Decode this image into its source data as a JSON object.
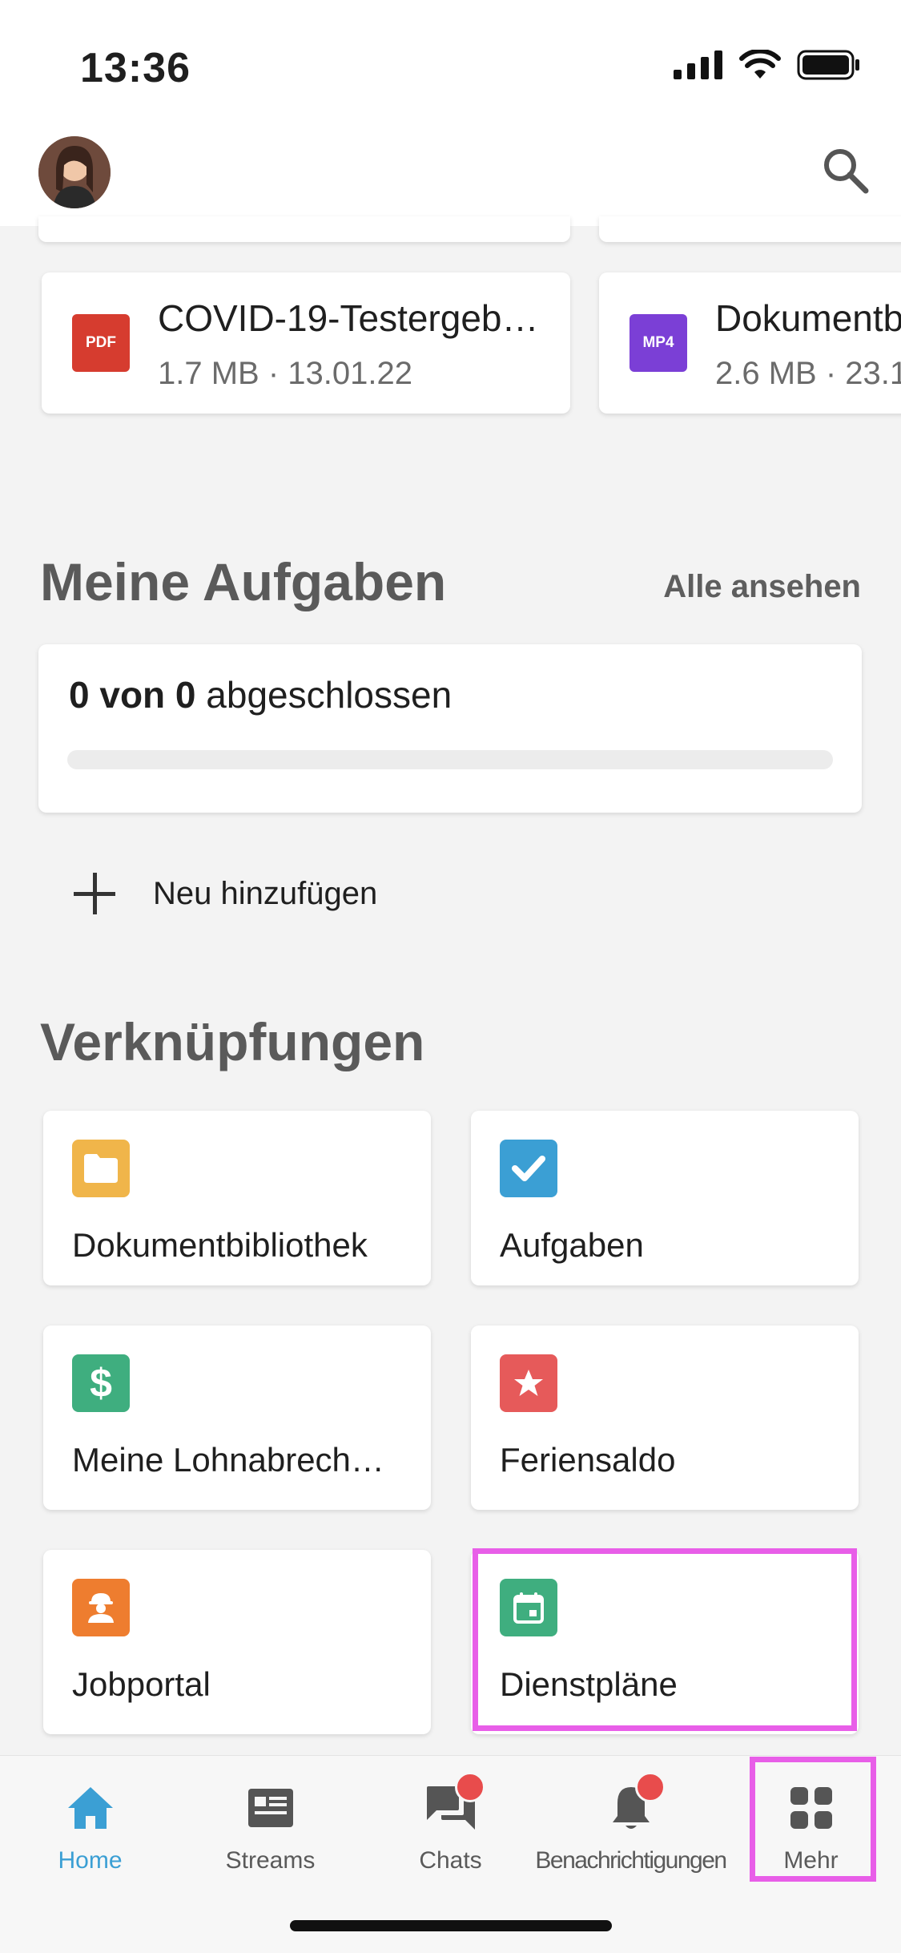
{
  "status_bar": {
    "time": "13:36"
  },
  "files": [
    {
      "type": "PDF",
      "name": "COVID-19-Testergeb…",
      "meta": "1.7 MB · 13.01.22",
      "color": "#d63c2f"
    },
    {
      "type": "MP4",
      "name": "Dokumentb",
      "meta": "2.6 MB · 23.1",
      "color": "#7b3fd6"
    }
  ],
  "tasks": {
    "title": "Meine Aufgaben",
    "see_all": "Alle ansehen",
    "status_bold": "0 von 0",
    "status_rest": "abgeschlossen",
    "progress": 0,
    "add_new": "Neu hinzufügen"
  },
  "shortcuts": {
    "title": "Verknüpfungen",
    "items": [
      {
        "label": "Dokumentbibliothek",
        "icon": "folder-icon",
        "color": "#f0b54a"
      },
      {
        "label": "Aufgaben",
        "icon": "checkbox-icon",
        "color": "#3b9fd4"
      },
      {
        "label": "Meine Lohnabrech…",
        "icon": "dollar-icon",
        "color": "#3fae7f"
      },
      {
        "label": "Feriensaldo",
        "icon": "star-icon",
        "color": "#e65a5a"
      },
      {
        "label": "Jobportal",
        "icon": "worker-icon",
        "color": "#ee7d2f"
      },
      {
        "label": "Dienstpläne",
        "icon": "calendar-icon",
        "color": "#3fae7f"
      }
    ]
  },
  "nav": {
    "items": [
      {
        "label": "Home",
        "icon": "home-icon"
      },
      {
        "label": "Streams",
        "icon": "streams-icon"
      },
      {
        "label": "Chats",
        "icon": "chats-icon"
      },
      {
        "label": "Benachrichtigungen",
        "icon": "bell-icon"
      },
      {
        "label": "Mehr",
        "icon": "grid-icon"
      }
    ],
    "active_color": "#3b9fd4"
  },
  "highlight_color": "#e85ee8"
}
